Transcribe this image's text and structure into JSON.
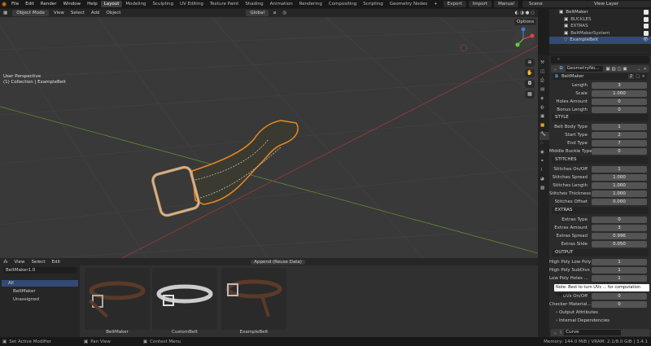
{
  "topbar": {
    "menus": [
      "File",
      "Edit",
      "Render",
      "Window",
      "Help"
    ],
    "workspaces": [
      "Layout",
      "Modeling",
      "Sculpting",
      "UV Editing",
      "Texture Paint",
      "Shading",
      "Animation",
      "Rendering",
      "Compositing",
      "Scripting",
      "Geometry Nodes"
    ],
    "buttons": [
      "Export",
      "Import",
      "Manual"
    ],
    "scene": "Scene",
    "view_layer": "View Layer"
  },
  "viewport": {
    "mode": "Object Mode",
    "menus": [
      "View",
      "Select",
      "Add",
      "Object"
    ],
    "orientation": "Global",
    "perspective_label": "User Perspective",
    "collection_label": "(1) Collection | ExampleBelt",
    "options_label": "Options"
  },
  "outliner": {
    "items": [
      "BeltMaker",
      "BUCKLES",
      "EXTRAS",
      "BeltMakerSystem",
      "ExampleBelt"
    ],
    "selected": "ExampleBelt"
  },
  "properties": {
    "modifier_name": "GeometryNo...",
    "node_group": "BeltMaker",
    "node_group_users": "2",
    "rows1": [
      {
        "label": "Length",
        "value": "3"
      },
      {
        "label": "Scale",
        "value": "1.000"
      },
      {
        "label": "Holes Amount",
        "value": "0"
      },
      {
        "label": "Bonus Length",
        "value": "0"
      }
    ],
    "style_header": "STYLE",
    "rows2": [
      {
        "label": "Belt Body Type",
        "value": "1"
      },
      {
        "label": "Start Type",
        "value": "2"
      },
      {
        "label": "End Type",
        "value": "7"
      },
      {
        "label": "Middle Buckle Type",
        "value": "0"
      }
    ],
    "stitches_header": "STITCHES",
    "rows3": [
      {
        "label": "Stitches On/Off",
        "value": "1"
      },
      {
        "label": "Stitches Spread",
        "value": "1.000"
      },
      {
        "label": "Stitches Length",
        "value": "1.000"
      },
      {
        "label": "Stitches Thickness",
        "value": "1.000"
      },
      {
        "label": "Stitches Offset",
        "value": "0.000"
      }
    ],
    "extras_header": "EXTRAS",
    "rows4": [
      {
        "label": "Extras Type",
        "value": "0"
      },
      {
        "label": "Extras Amount",
        "value": "3"
      },
      {
        "label": "Extras Spread",
        "value": "0.996"
      },
      {
        "label": "Extras Slide",
        "value": "0.050"
      }
    ],
    "output_header": "OUTPUT",
    "rows5": [
      {
        "label": "High Poly Low Poly",
        "value": "1"
      },
      {
        "label": "High Poly SubDivs",
        "value": "1"
      },
      {
        "label": "Low Poly Holes ...",
        "value": "1"
      }
    ],
    "tooltip": "Note: Best to turn UVs ... for computation speed.",
    "rows6": [
      {
        "label": "UVs On/Off",
        "value": "0"
      },
      {
        "label": "Checker Material...",
        "value": "0"
      }
    ],
    "output_attributes": "Output Attributes",
    "internal_dependencies": "Internal Dependencies",
    "data_name": "Curve"
  },
  "asset_browser": {
    "menus": [
      "View",
      "Select",
      "Edit"
    ],
    "library": "BeltMaker1.0",
    "import_mode": "Append (Reuse Data)",
    "catalogs": [
      "All",
      "BeltMaker",
      "Unassigned"
    ],
    "assets": [
      "BeltMaker",
      "CustomBelt",
      "ExampleBelt"
    ]
  },
  "status": {
    "left_items": [
      "Set Active Modifier",
      "Pan View",
      "Context Menu"
    ],
    "right_text": "Memory: 144.0 MiB | VRAM: 2.1/8.0 GiB | 3.4.1"
  },
  "colors": {
    "accent": "#e87d0d",
    "selection": "#334a74",
    "viewport_bg": "#393939"
  }
}
